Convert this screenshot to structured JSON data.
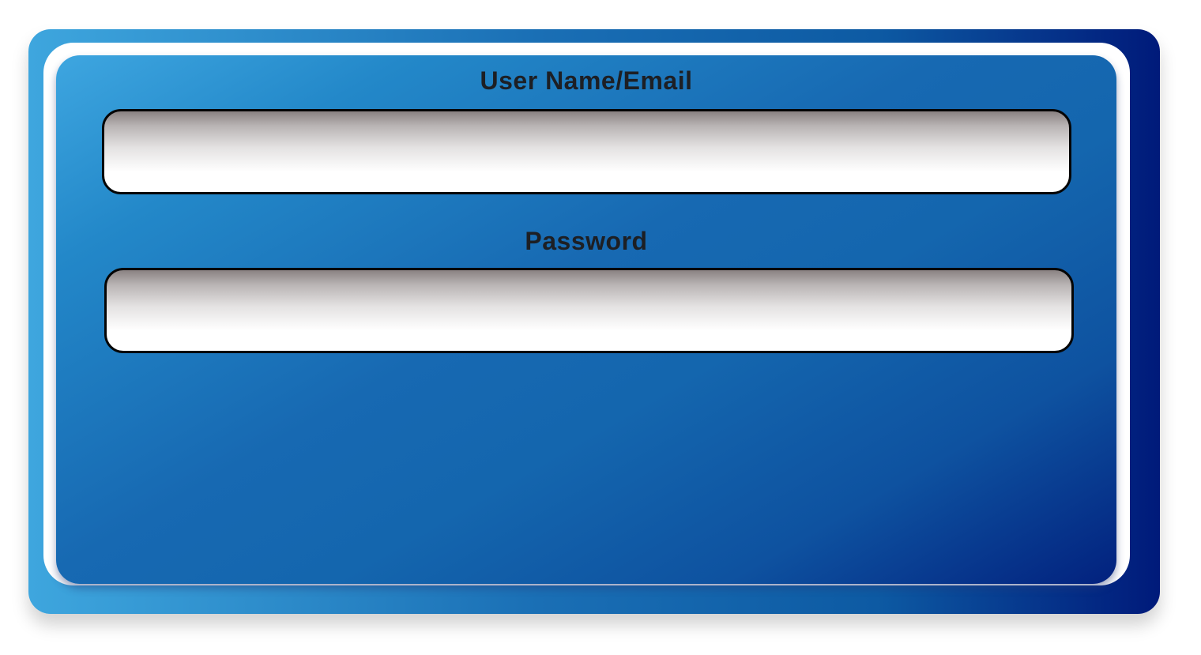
{
  "login_form": {
    "username": {
      "label": "User Name/Email",
      "value": "",
      "placeholder": ""
    },
    "password": {
      "label": "Password",
      "value": "",
      "placeholder": ""
    }
  },
  "colors": {
    "panel_light": "#3ea6e0",
    "panel_mid": "#1769b2",
    "panel_dark": "#02217e",
    "label_text": "#1d1f24",
    "input_border": "#050505"
  }
}
